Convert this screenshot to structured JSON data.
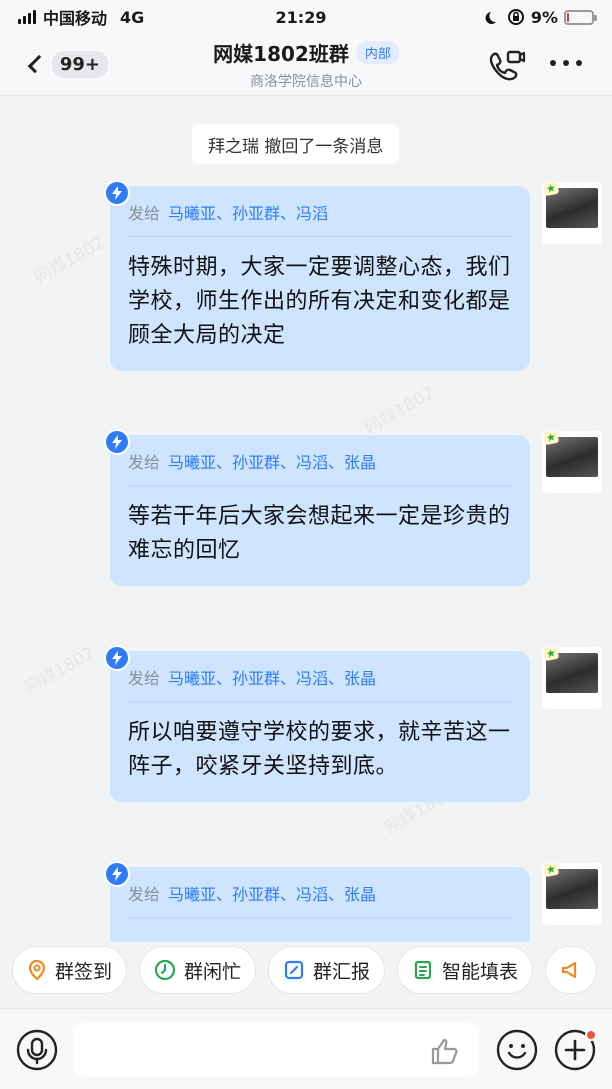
{
  "status_bar": {
    "carrier": "中国移动",
    "network": "4G",
    "time": "21:29",
    "battery": "9%",
    "battery_level": 0.09
  },
  "header": {
    "back_badge": "99+",
    "title": "网媒1802班群",
    "tag": "内部",
    "subtitle": "商洛学院信息中心"
  },
  "chat": {
    "system_message": "拜之瑞 撤回了一条消息",
    "messages": [
      {
        "recipients_prefix": "发给",
        "recipients": "马曦亚、孙亚群、冯滔",
        "text": "特殊时期，大家一定要调整心态，我们学校，师生作出的所有决定和变化都是顾全大局的决定"
      },
      {
        "recipients_prefix": "发给",
        "recipients": "马曦亚、孙亚群、冯滔、张晶",
        "text": "等若干年后大家会想起来一定是珍贵的难忘的回忆"
      },
      {
        "recipients_prefix": "发给",
        "recipients": "马曦亚、孙亚群、冯滔、张晶",
        "text": "所以咱要遵守学校的要求，就辛苦这一阵子，咬紧牙关坚持到底。"
      },
      {
        "recipients_prefix": "发给",
        "recipients": "马曦亚、孙亚群、冯滔、张晶",
        "text": ""
      }
    ]
  },
  "quick_actions": [
    {
      "label": "群签到",
      "icon": "location-pin-icon"
    },
    {
      "label": "群闲忙",
      "icon": "clock-icon"
    },
    {
      "label": "群汇报",
      "icon": "report-edit-icon"
    },
    {
      "label": "智能填表",
      "icon": "form-icon"
    }
  ],
  "input": {
    "placeholder": ""
  },
  "colors": {
    "accent": "#2f7cf6",
    "bubble": "#cfe5ff",
    "background": "#f2f3f5",
    "notification_dot": "#f5533d"
  }
}
